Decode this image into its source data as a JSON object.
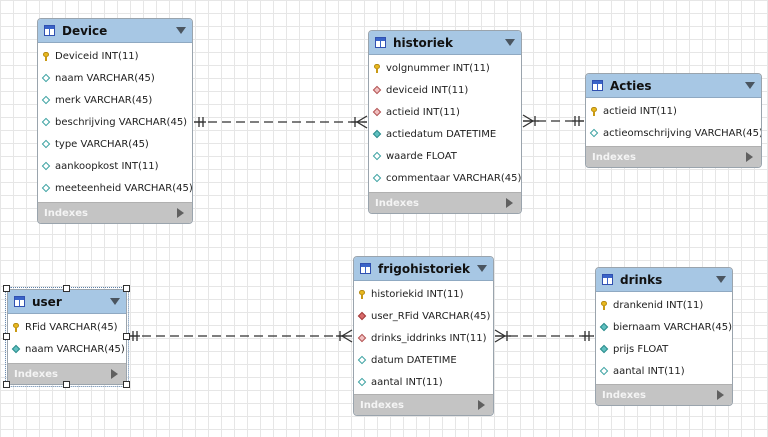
{
  "diagram": {
    "tables": [
      {
        "id": "device",
        "name": "Device",
        "columns": [
          {
            "text": "Deviceid INT(11)",
            "icon": "primary-key-icon",
            "kind": "pk"
          },
          {
            "text": "naam VARCHAR(45)",
            "icon": "column-icon",
            "kind": "attr"
          },
          {
            "text": "merk VARCHAR(45)",
            "icon": "column-icon",
            "kind": "attr"
          },
          {
            "text": "beschrijving VARCHAR(45)",
            "icon": "column-icon",
            "kind": "attr"
          },
          {
            "text": "type VARCHAR(45)",
            "icon": "column-icon",
            "kind": "attr"
          },
          {
            "text": "aankoopkost INT(11)",
            "icon": "column-icon",
            "kind": "attr"
          },
          {
            "text": "meeteenheid VARCHAR(45)",
            "icon": "column-icon",
            "kind": "attr"
          }
        ],
        "indexes_label": "Indexes"
      },
      {
        "id": "historiek",
        "name": "historiek",
        "columns": [
          {
            "text": "volgnummer INT(11)",
            "icon": "primary-key-icon",
            "kind": "pk"
          },
          {
            "text": "deviceid INT(11)",
            "icon": "foreign-key-icon",
            "kind": "fk"
          },
          {
            "text": "actieid INT(11)",
            "icon": "foreign-key-icon",
            "kind": "fk"
          },
          {
            "text": "actiedatum DATETIME",
            "icon": "column-filled-icon",
            "kind": "attr-filled"
          },
          {
            "text": "waarde FLOAT",
            "icon": "column-icon",
            "kind": "attr"
          },
          {
            "text": "commentaar VARCHAR(45)",
            "icon": "column-icon",
            "kind": "attr"
          }
        ],
        "indexes_label": "Indexes"
      },
      {
        "id": "acties",
        "name": "Acties",
        "columns": [
          {
            "text": "actieid INT(11)",
            "icon": "primary-key-icon",
            "kind": "pk"
          },
          {
            "text": "actieomschrijving VARCHAR(45)",
            "icon": "column-icon",
            "kind": "attr"
          }
        ],
        "indexes_label": "Indexes"
      },
      {
        "id": "user",
        "name": "user",
        "selected": true,
        "columns": [
          {
            "text": "RFid VARCHAR(45)",
            "icon": "primary-key-icon",
            "kind": "pk"
          },
          {
            "text": "naam VARCHAR(45)",
            "icon": "column-filled-icon",
            "kind": "attr-filled"
          }
        ],
        "indexes_label": "Indexes"
      },
      {
        "id": "frigohistoriek",
        "name": "frigohistoriek",
        "columns": [
          {
            "text": "historiekid INT(11)",
            "icon": "primary-key-icon",
            "kind": "pk"
          },
          {
            "text": "user_RFid VARCHAR(45)",
            "icon": "foreign-key-filled-icon",
            "kind": "fk-filled"
          },
          {
            "text": "drinks_iddrinks INT(11)",
            "icon": "foreign-key-icon",
            "kind": "fk"
          },
          {
            "text": "datum DATETIME",
            "icon": "column-icon",
            "kind": "attr"
          },
          {
            "text": "aantal INT(11)",
            "icon": "column-icon",
            "kind": "attr"
          }
        ],
        "indexes_label": "Indexes"
      },
      {
        "id": "drinks",
        "name": "drinks",
        "columns": [
          {
            "text": "drankenid INT(11)",
            "icon": "primary-key-icon",
            "kind": "pk"
          },
          {
            "text": "biernaam VARCHAR(45)",
            "icon": "column-filled-icon",
            "kind": "attr-filled"
          },
          {
            "text": "prijs FLOAT",
            "icon": "column-filled-icon",
            "kind": "attr-filled"
          },
          {
            "text": "aantal INT(11)",
            "icon": "column-icon",
            "kind": "attr"
          }
        ],
        "indexes_label": "Indexes"
      }
    ],
    "relationships": [
      {
        "from": "device",
        "to": "historiek",
        "from_card": "one",
        "to_card": "many",
        "style": "dashed"
      },
      {
        "from": "acties",
        "to": "historiek",
        "from_card": "one",
        "to_card": "many",
        "style": "dashed"
      },
      {
        "from": "user",
        "to": "frigohistoriek",
        "from_card": "one",
        "to_card": "many",
        "style": "dashed"
      },
      {
        "from": "drinks",
        "to": "frigohistoriek",
        "from_card": "one",
        "to_card": "many",
        "style": "dashed"
      }
    ],
    "colors": {
      "header": "#a7c7e4",
      "indexes_bar": "#c4c4c4",
      "line": "#303030",
      "grid": "#e6e6e6"
    }
  }
}
